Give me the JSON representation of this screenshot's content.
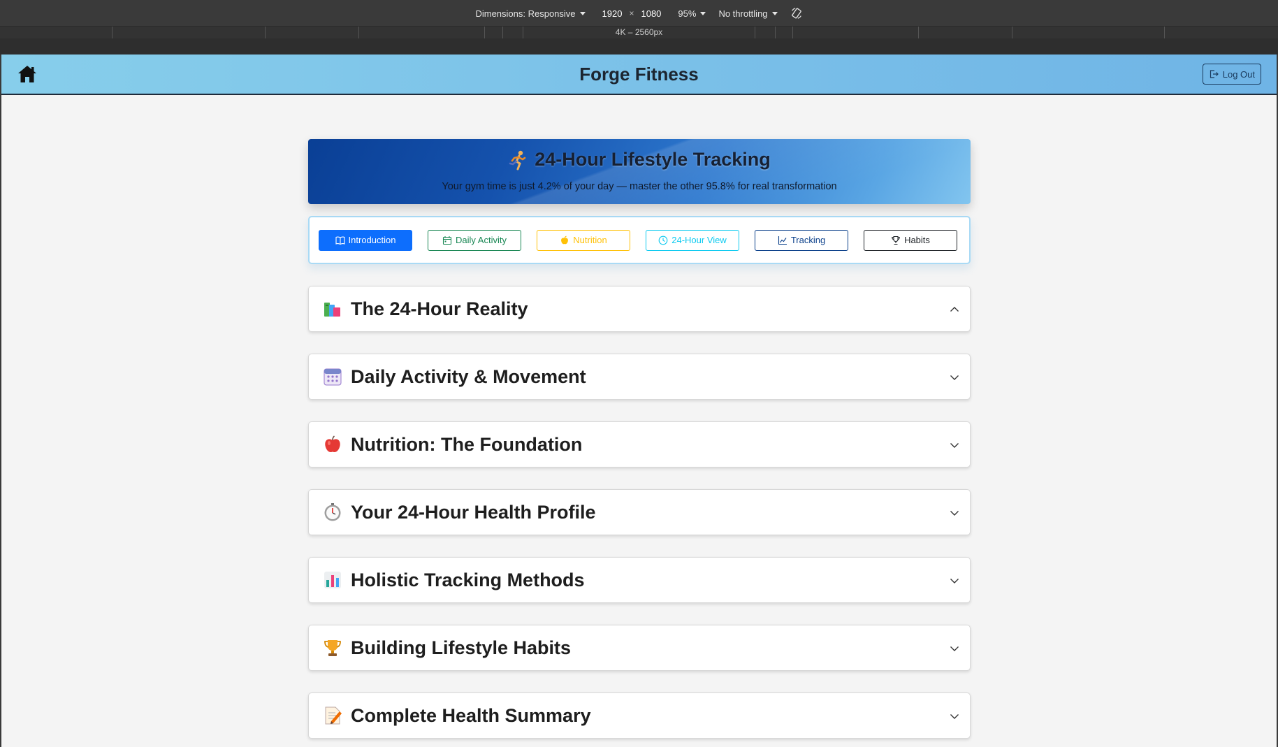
{
  "devtools": {
    "dimensions_label": "Dimensions: Responsive",
    "width": "1920",
    "times": "×",
    "height": "1080",
    "zoom": "95%",
    "throttling": "No throttling",
    "ruler_label": "4K – 2560px"
  },
  "nav": {
    "brand": "Forge Fitness",
    "logout_label": "Log Out",
    "home_icon": "home-icon",
    "bg_colors": [
      "#87ceeb",
      "#6fb4e6"
    ]
  },
  "hero": {
    "title": "24-Hour Lifestyle Tracking",
    "subtitle": "Your gym time is just 4.2% of your day — master the other 95.8% for real transformation",
    "icon": "runner-emoji-icon"
  },
  "tabs": [
    {
      "label": "Introduction",
      "icon": "book-icon",
      "color": "#0d6efd",
      "active": true
    },
    {
      "label": "Daily Activity",
      "icon": "calendar-icon",
      "color": "#198754",
      "active": false
    },
    {
      "label": "Nutrition",
      "icon": "apple-icon",
      "color": "#ffc107",
      "active": false
    },
    {
      "label": "24-Hour View",
      "icon": "clock-icon",
      "color": "#0dcaf0",
      "active": false
    },
    {
      "label": "Tracking",
      "icon": "chart-line-icon",
      "color": "#0a3f8a",
      "active": false
    },
    {
      "label": "Habits",
      "icon": "trophy-icon",
      "color": "#212529",
      "active": false
    }
  ],
  "sections": [
    {
      "title": "The 24-Hour Reality",
      "icon": "books-emoji-icon",
      "expanded": true
    },
    {
      "title": "Daily Activity & Movement",
      "icon": "calendar-emoji-icon",
      "expanded": false
    },
    {
      "title": "Nutrition: The Foundation",
      "icon": "apple-emoji-icon",
      "expanded": false
    },
    {
      "title": "Your 24-Hour Health Profile",
      "icon": "stopwatch-emoji-icon",
      "expanded": false
    },
    {
      "title": "Holistic Tracking Methods",
      "icon": "bar-chart-emoji-icon",
      "expanded": false
    },
    {
      "title": "Building Lifestyle Habits",
      "icon": "trophy-emoji-icon",
      "expanded": false
    },
    {
      "title": "Complete Health Summary",
      "icon": "memo-emoji-icon",
      "expanded": false
    }
  ]
}
